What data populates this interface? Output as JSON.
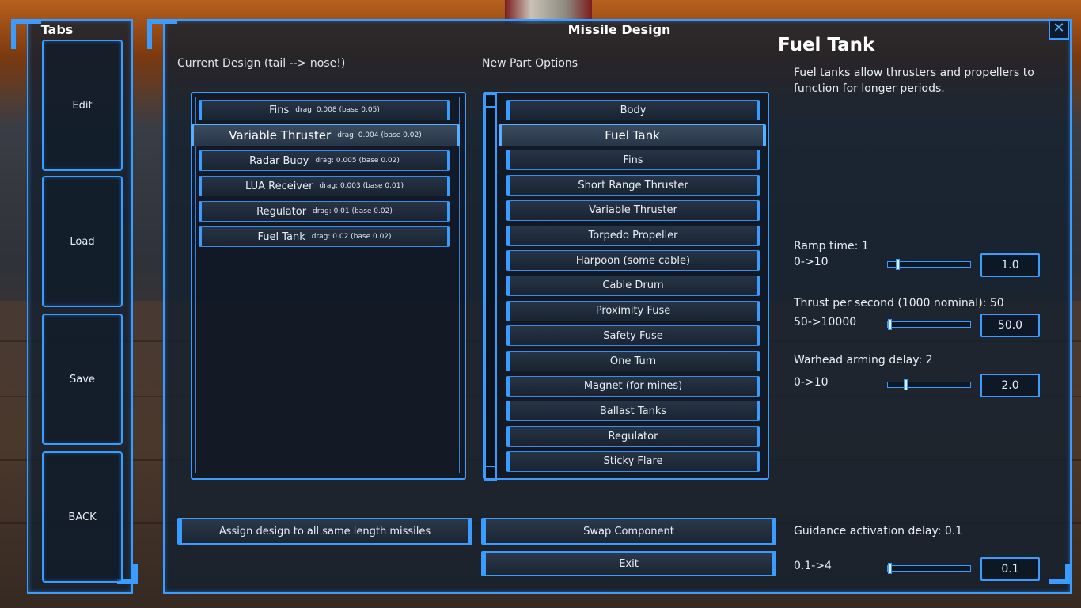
{
  "tabs": {
    "title": "Tabs",
    "items": [
      {
        "label": "Edit"
      },
      {
        "label": "Load"
      },
      {
        "label": "Save"
      },
      {
        "label": "BACK"
      }
    ]
  },
  "window": {
    "title": "Missile Design",
    "close_icon": "close-icon"
  },
  "current_design": {
    "label": "Current Design (tail --> nose!)",
    "items": [
      {
        "name": "Fins",
        "drag": "drag: 0.008 (base 0.05)",
        "selected": false
      },
      {
        "name": "Variable Thruster",
        "drag": "drag: 0.004 (base 0.02)",
        "selected": true
      },
      {
        "name": "Radar Buoy",
        "drag": "drag: 0.005 (base 0.02)",
        "selected": false
      },
      {
        "name": "LUA Receiver",
        "drag": "drag: 0.003 (base 0.01)",
        "selected": false
      },
      {
        "name": "Regulator",
        "drag": "drag: 0.01 (base 0.02)",
        "selected": false
      },
      {
        "name": "Fuel Tank",
        "drag": "drag: 0.02 (base 0.02)",
        "selected": false
      }
    ]
  },
  "new_part_options": {
    "label": "New Part Options",
    "items": [
      {
        "name": "Body",
        "selected": false
      },
      {
        "name": "Fuel Tank",
        "selected": true
      },
      {
        "name": "Fins",
        "selected": false
      },
      {
        "name": "Short Range Thruster",
        "selected": false
      },
      {
        "name": "Variable Thruster",
        "selected": false
      },
      {
        "name": "Torpedo Propeller",
        "selected": false
      },
      {
        "name": "Harpoon (some cable)",
        "selected": false
      },
      {
        "name": "Cable Drum",
        "selected": false
      },
      {
        "name": "Proximity Fuse",
        "selected": false
      },
      {
        "name": "Safety Fuse",
        "selected": false
      },
      {
        "name": "One Turn",
        "selected": false
      },
      {
        "name": "Magnet (for mines)",
        "selected": false
      },
      {
        "name": "Ballast Tanks",
        "selected": false
      },
      {
        "name": "Regulator",
        "selected": false
      },
      {
        "name": "Sticky Flare",
        "selected": false
      }
    ]
  },
  "detail": {
    "title": "Fuel Tank",
    "description": "Fuel tanks allow thrusters and propellers to function for longer periods."
  },
  "params": [
    {
      "label": "Ramp time: 1",
      "range": "0->10",
      "value": "1.0",
      "fraction": 0.1
    },
    {
      "label": "Thrust per second (1000 nominal): 50",
      "range": "50->10000",
      "value": "50.0",
      "fraction": 0.0
    },
    {
      "label": "Warhead arming delay: 2",
      "range": "0->10",
      "value": "2.0",
      "fraction": 0.2
    },
    {
      "label": "Guidance activation delay: 0.1",
      "range": "0.1->4",
      "value": "0.1",
      "fraction": 0.0
    }
  ],
  "buttons": {
    "assign": "Assign design to all same length missiles",
    "swap": "Swap Component",
    "exit": "Exit"
  },
  "colors": {
    "accent": "#3a9cff",
    "panel": "#14202e"
  }
}
